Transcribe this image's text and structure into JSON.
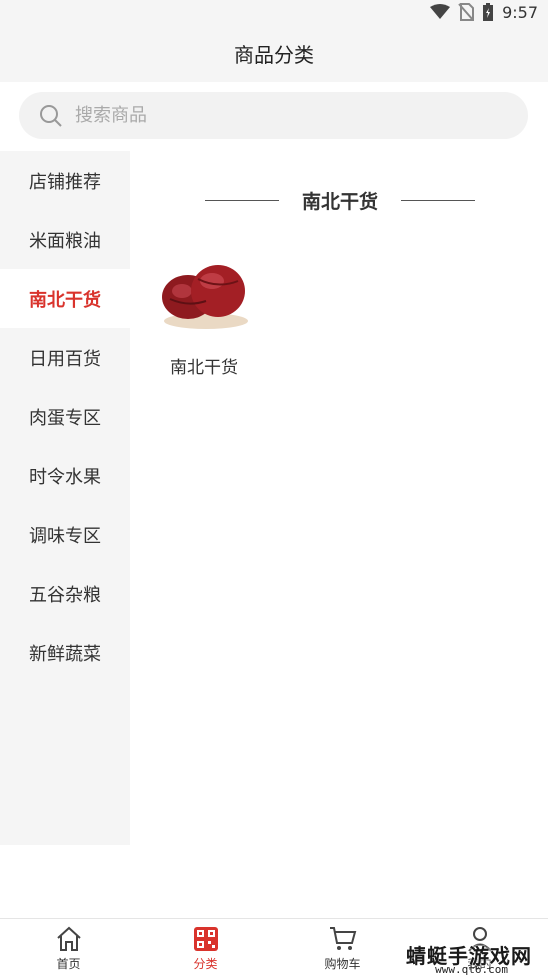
{
  "status_bar": {
    "time": "9:57"
  },
  "header": {
    "title": "商品分类"
  },
  "search": {
    "placeholder": "搜索商品"
  },
  "sidebar": {
    "items": [
      {
        "label": "店铺推荐"
      },
      {
        "label": "米面粮油"
      },
      {
        "label": "南北干货",
        "active": true
      },
      {
        "label": "日用百货"
      },
      {
        "label": "肉蛋专区"
      },
      {
        "label": "时令水果"
      },
      {
        "label": "调味专区"
      },
      {
        "label": "五谷杂粮"
      },
      {
        "label": "新鲜蔬菜"
      }
    ]
  },
  "content": {
    "section_title": "南北干货",
    "goods": [
      {
        "label": "南北干货",
        "image": "red-dates-image"
      }
    ]
  },
  "tabbar": {
    "tabs": [
      {
        "label": "首页",
        "icon": "home-icon"
      },
      {
        "label": "分类",
        "icon": "category-grid-icon",
        "active": true
      },
      {
        "label": "购物车",
        "icon": "cart-icon"
      },
      {
        "label": "我的",
        "icon": "user-icon"
      }
    ]
  },
  "watermark": {
    "text": "蜻蜓手游戏网",
    "url": "www.qt6.com"
  },
  "colors": {
    "accent": "#d9332c",
    "sidebar_bg": "#f5f5f5",
    "header_bg": "#f5f5f5"
  }
}
